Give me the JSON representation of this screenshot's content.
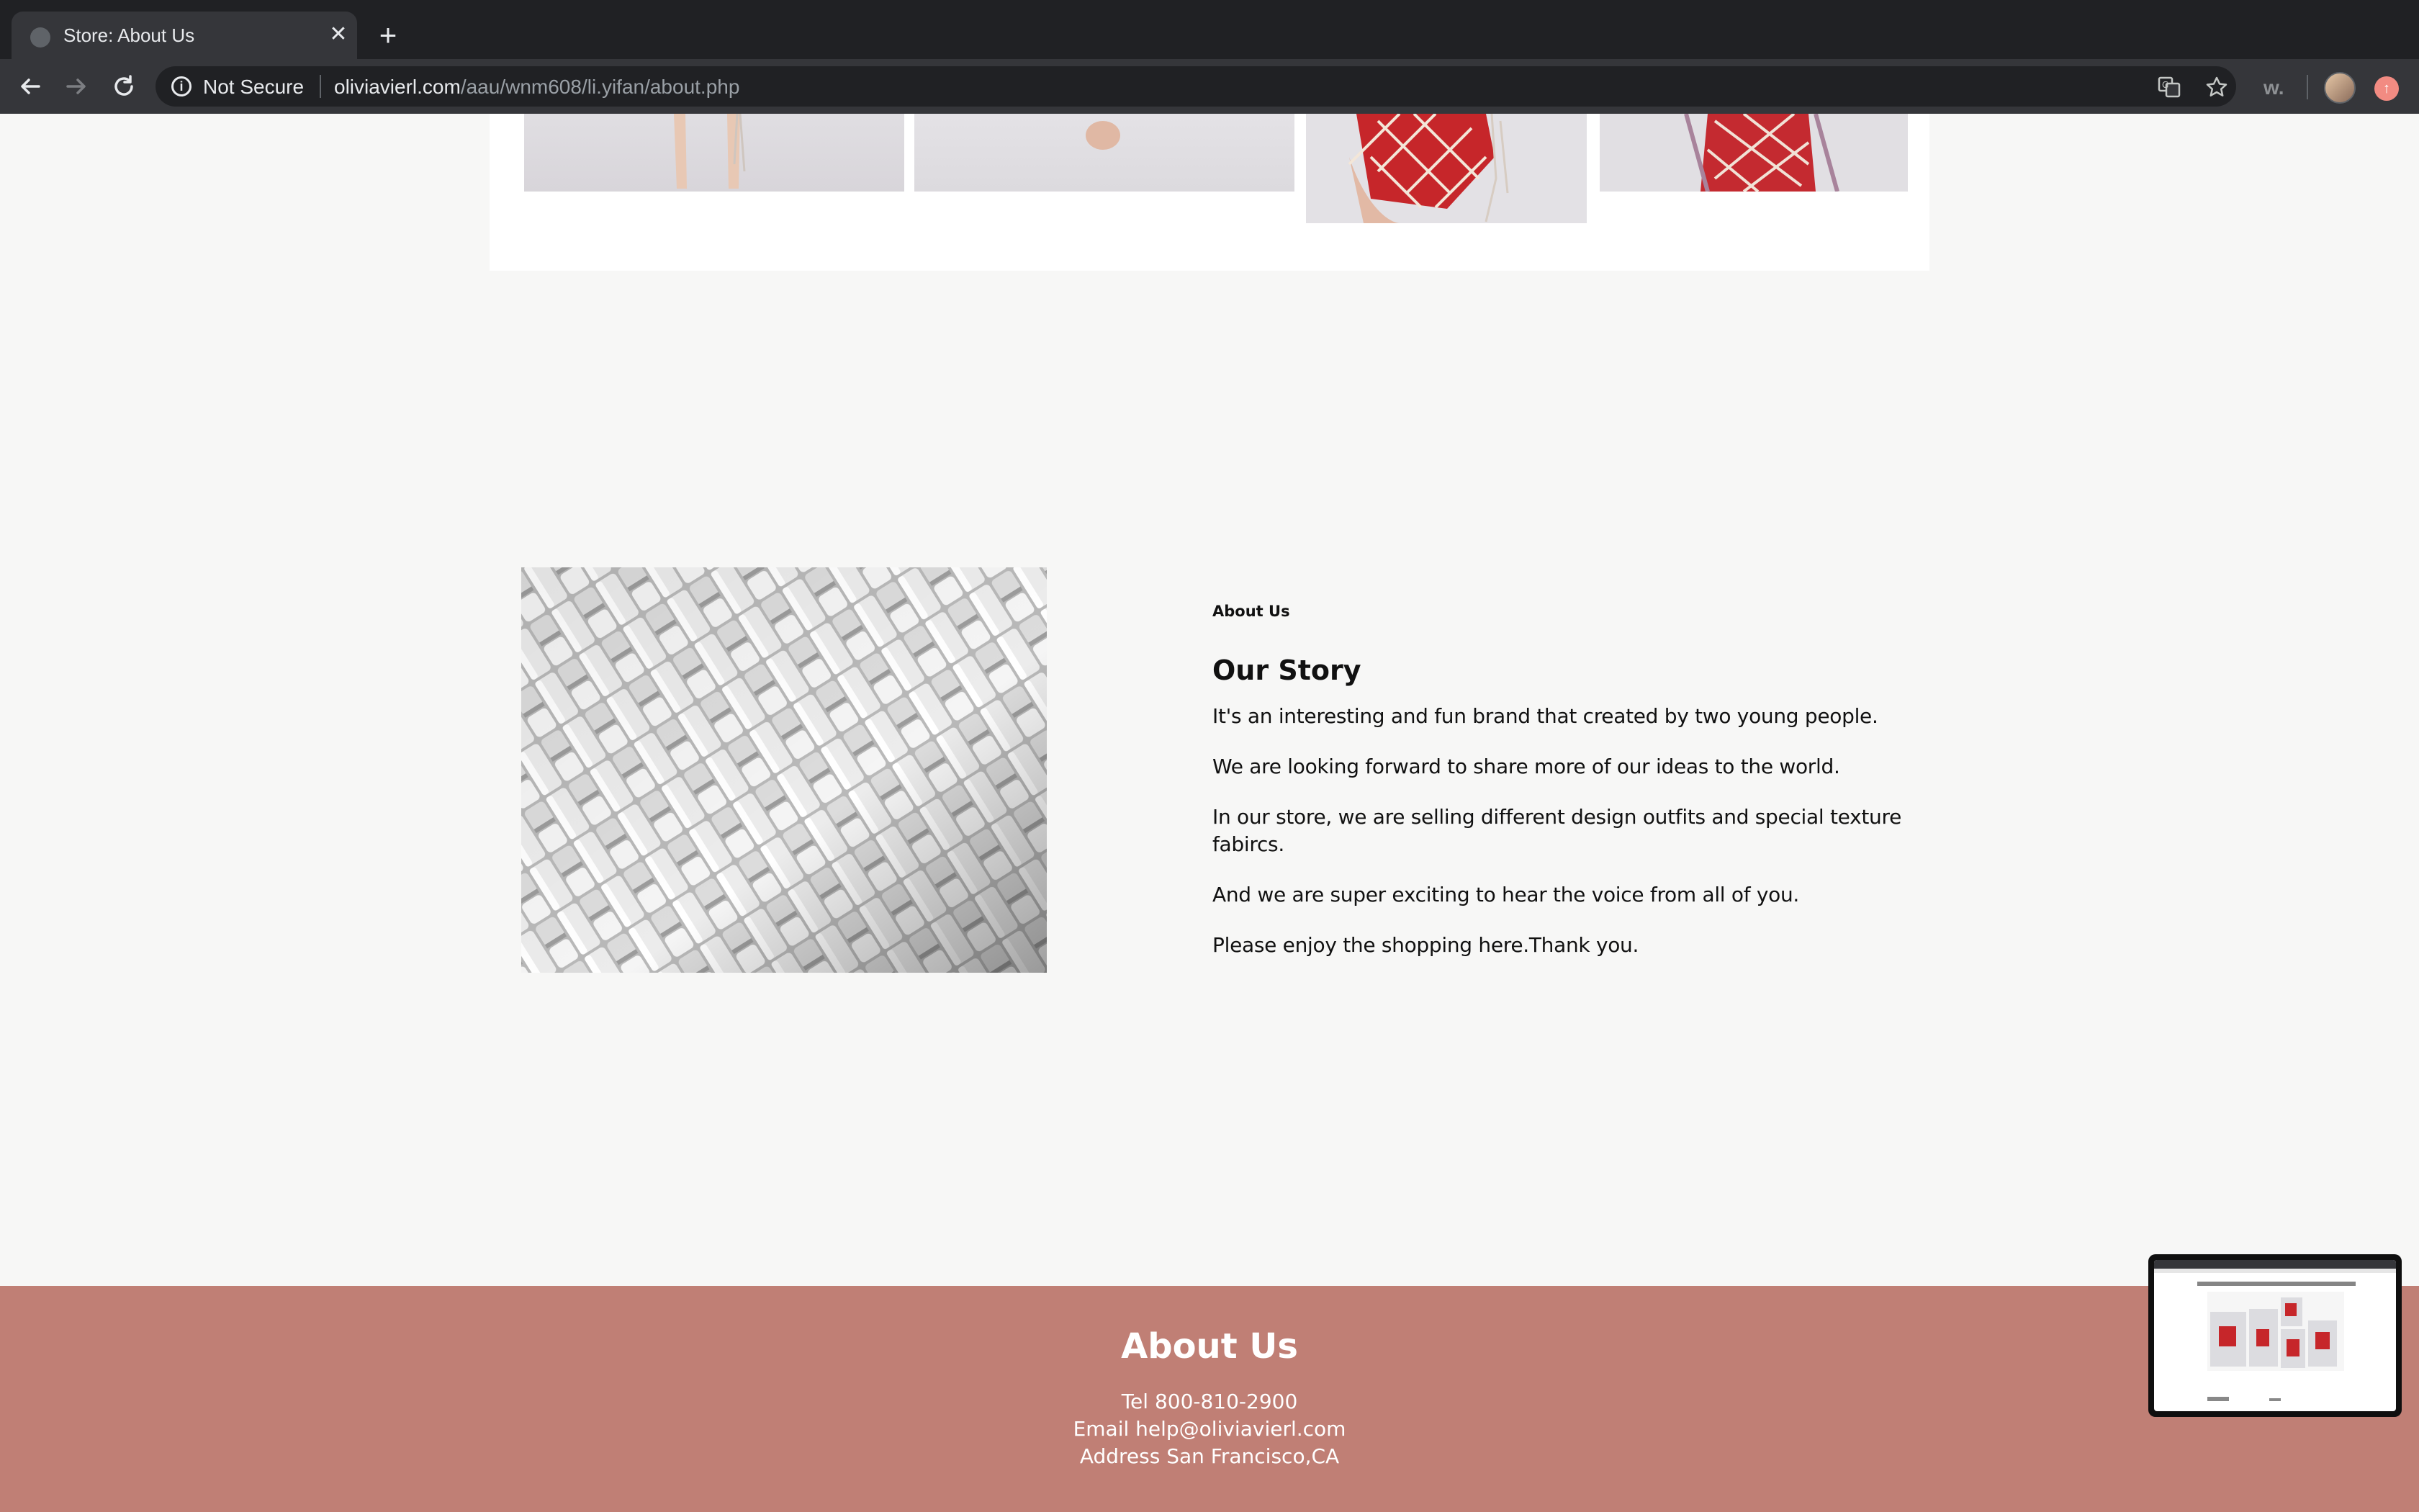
{
  "browser": {
    "tab_title": "Store: About Us",
    "new_tab_label": "+",
    "security_label": "Not Secure",
    "url_host": "oliviavierl.com",
    "url_path": "/aau/wnm608/li.yifan/about.php",
    "extension_label": "w."
  },
  "icons": {
    "back": "back-arrow-icon",
    "forward": "forward-arrow-icon",
    "reload": "reload-icon",
    "info": "info-icon",
    "translate": "translate-icon",
    "bookmark": "star-icon",
    "close": "close-icon"
  },
  "about": {
    "eyebrow": "About Us",
    "title": "Our Story",
    "paragraphs": [
      "It's an interesting and fun brand that created by two young people.",
      "We are looking forward to share more of our ideas to the world.",
      "In our store, we are selling different design outfits and special texture fabircs.",
      "And we are super exciting to hear the voice from all of you.",
      "Please enjoy the shopping here.Thank you."
    ]
  },
  "footer": {
    "title": "About Us",
    "tel": "Tel 800-810-2900",
    "email": "Email help@oliviavierl.com",
    "address": "Address San Francisco,CA"
  },
  "colors": {
    "footer_bg": "#c07f75",
    "page_bg": "#f7f7f6",
    "accent_red": "#c6262a"
  }
}
